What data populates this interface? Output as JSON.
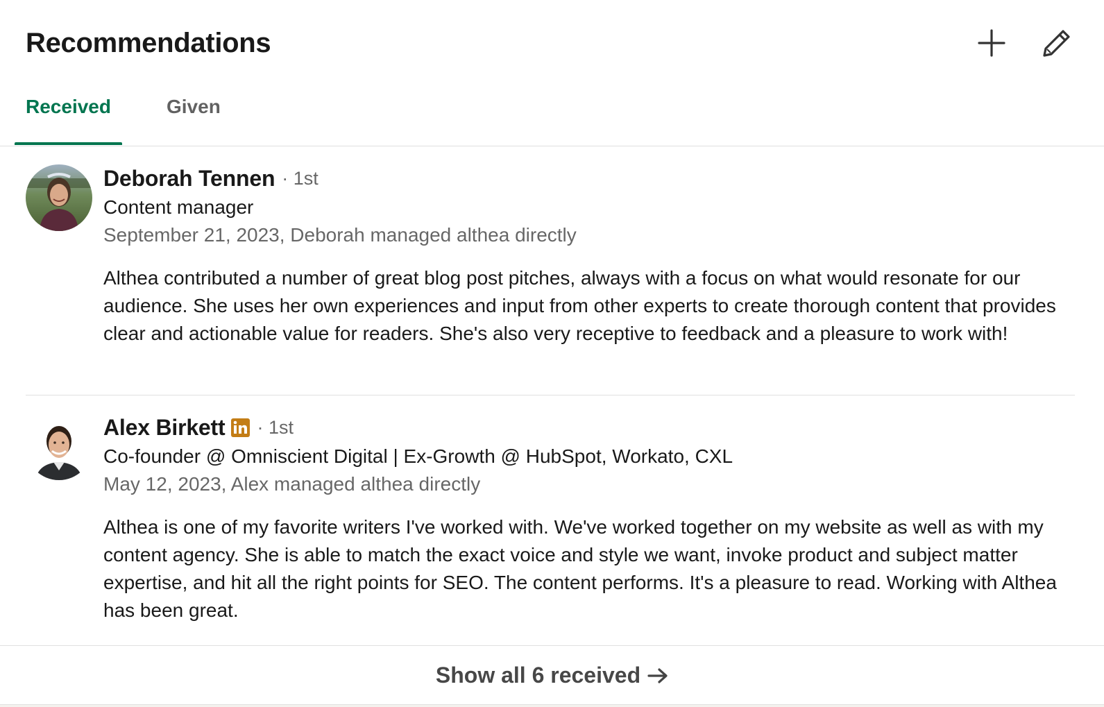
{
  "section": {
    "title": "Recommendations"
  },
  "icons": {
    "add": "plus-icon",
    "edit": "pencil-icon",
    "linkedin_badge": "linkedin-icon",
    "arrow": "arrow-right-icon"
  },
  "tabs": [
    {
      "label": "Received",
      "active": true
    },
    {
      "label": "Given",
      "active": false
    }
  ],
  "recommendations": [
    {
      "name": "Deborah Tennen",
      "degree": "· 1st",
      "headline": "Content manager",
      "meta": "September 21, 2023, Deborah managed althea directly",
      "text": "Althea contributed a number of great blog post pitches, always with a focus on what would resonate for our audience. She uses her own experiences and input from other experts to create thorough content that provides clear and actionable value for readers. She's also very receptive to feedback and a pleasure to work with!"
    },
    {
      "name": "Alex Birkett",
      "degree": "· 1st",
      "headline": "Co-founder @ Omniscient Digital | Ex-Growth @ HubSpot, Workato, CXL",
      "meta": "May 12, 2023, Alex managed althea directly",
      "text": "Althea is one of my favorite writers I've worked with. We've worked together on my website as well as with my content agency. She is able to match the exact voice and style we want, invoke product and subject matter expertise, and hit all the right points for SEO. The content performs. It's a pleasure to read. Working with Althea has been great."
    }
  ],
  "footer": {
    "label": "Show all 6 received"
  },
  "colors": {
    "accent": "#01754f",
    "linkedin_badge": "#c37d16"
  }
}
